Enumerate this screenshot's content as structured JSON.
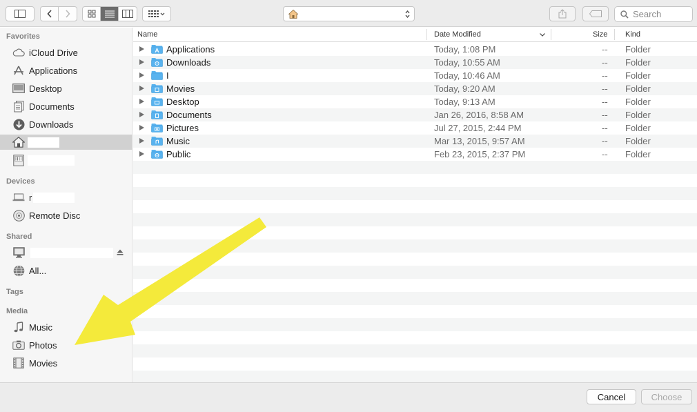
{
  "toolbar": {
    "sidebar_toggle_icon": "sidebar-icon",
    "back_icon": "chevron-left-icon",
    "forward_icon": "chevron-right-icon",
    "view_modes": [
      {
        "name": "icon-view",
        "icon": "grid-icon",
        "active": false
      },
      {
        "name": "list-view",
        "icon": "list-icon",
        "active": true
      },
      {
        "name": "column-view",
        "icon": "columns-icon",
        "active": false
      }
    ],
    "arrange_icon": "arrange-grid-icon",
    "location_icon": "home-icon",
    "share_icon": "share-icon",
    "tag_icon": "tag-icon",
    "search_placeholder": "Search"
  },
  "sidebar": {
    "favorites_title": "Favorites",
    "favorites": [
      {
        "label": "iCloud Drive",
        "icon": "cloud-icon"
      },
      {
        "label": "Applications",
        "icon": "applications-icon"
      },
      {
        "label": "Desktop",
        "icon": "desktop-icon"
      },
      {
        "label": "Documents",
        "icon": "documents-icon"
      },
      {
        "label": "Downloads",
        "icon": "downloads-icon"
      },
      {
        "label": "",
        "icon": "home-icon",
        "selected": true
      },
      {
        "label": "",
        "icon": "drive-icon"
      }
    ],
    "devices_title": "Devices",
    "devices": [
      {
        "label": "r",
        "icon": "laptop-icon"
      },
      {
        "label": "Remote Disc",
        "icon": "disc-icon"
      }
    ],
    "shared_title": "Shared",
    "shared": [
      {
        "label": "",
        "icon": "monitor-icon",
        "eject": true
      },
      {
        "label": "All...",
        "icon": "network-icon"
      }
    ],
    "tags_title": "Tags",
    "media_title": "Media",
    "media": [
      {
        "label": "Music",
        "icon": "music-icon"
      },
      {
        "label": "Photos",
        "icon": "camera-icon"
      },
      {
        "label": "Movies",
        "icon": "film-icon"
      }
    ]
  },
  "table": {
    "headers": {
      "name": "Name",
      "date": "Date Modified",
      "size": "Size",
      "kind": "Kind"
    },
    "rows": [
      {
        "name": "Applications",
        "date": "Today, 1:08 PM",
        "size": "--",
        "kind": "Folder"
      },
      {
        "name": "Downloads",
        "date": "Today, 10:55 AM",
        "size": "--",
        "kind": "Folder"
      },
      {
        "name": "I",
        "date": "Today, 10:46 AM",
        "size": "--",
        "kind": "Folder"
      },
      {
        "name": "Movies",
        "date": "Today, 9:20 AM",
        "size": "--",
        "kind": "Folder"
      },
      {
        "name": "Desktop",
        "date": "Today, 9:13 AM",
        "size": "--",
        "kind": "Folder"
      },
      {
        "name": "Documents",
        "date": "Jan 26, 2016, 8:58 AM",
        "size": "--",
        "kind": "Folder"
      },
      {
        "name": "Pictures",
        "date": "Jul 27, 2015, 2:44 PM",
        "size": "--",
        "kind": "Folder"
      },
      {
        "name": "Music",
        "date": "Mar 13, 2015, 9:57 AM",
        "size": "--",
        "kind": "Folder"
      },
      {
        "name": "Public",
        "date": "Feb 23, 2015, 2:37 PM",
        "size": "--",
        "kind": "Folder"
      }
    ]
  },
  "buttons": {
    "cancel": "Cancel",
    "choose": "Choose"
  },
  "colors": {
    "folder": "#59b3ef",
    "annotation_arrow": "#f4ea3b",
    "selection": "#d1d1d1"
  }
}
